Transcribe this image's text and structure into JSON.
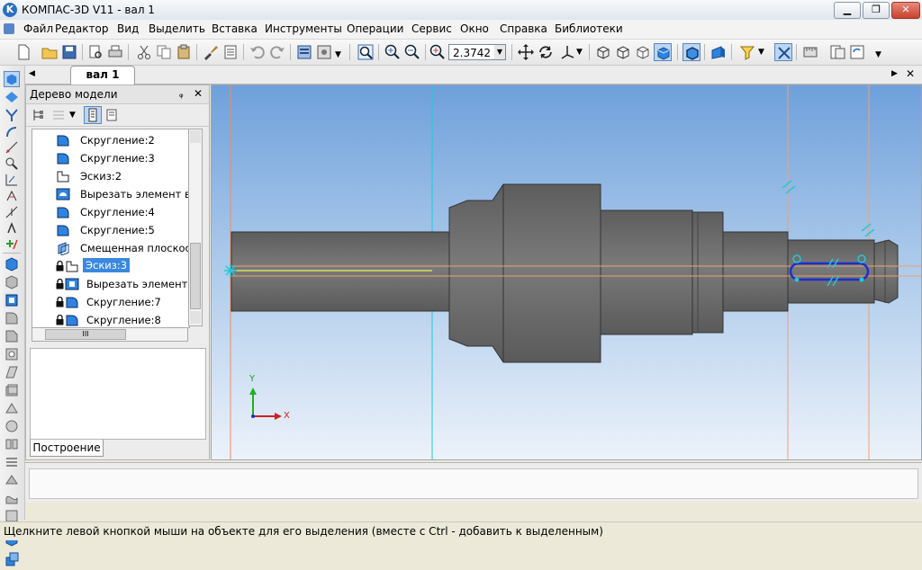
{
  "window": {
    "title": "КОМПАС-3D V11 - вал 1",
    "logo_letter": "K",
    "minimize_glyph": "▁",
    "restore_glyph": "❐",
    "close_glyph": "✕"
  },
  "menu": [
    "Файл",
    "Редактор",
    "Вид",
    "Выделить",
    "Вставка",
    "Инструменты",
    "Операции",
    "Сервис",
    "Окно",
    "Справка",
    "Библиотеки"
  ],
  "toolbar": {
    "zoom_value": "2.3742",
    "dropdown_glyph": "▼"
  },
  "document_tab": {
    "label": "вал 1",
    "left_arrow": "◀",
    "right_arrow": "▶",
    "close_glyph": "✕"
  },
  "model_tree": {
    "title": "Дерево модели",
    "pin_glyph": "ᵩ",
    "close_glyph": "✕",
    "items": [
      {
        "label": "Скругление:2",
        "icon": "fillet-icon",
        "locked": false,
        "selected": false
      },
      {
        "label": "Скругление:3",
        "icon": "fillet-icon",
        "locked": false,
        "selected": false
      },
      {
        "label": "Эскиз:2",
        "icon": "sketch-icon",
        "locked": false,
        "selected": false
      },
      {
        "label": "Вырезать элемент вр",
        "icon": "cut-revolve-icon",
        "locked": false,
        "selected": false
      },
      {
        "label": "Скругление:4",
        "icon": "fillet-icon",
        "locked": false,
        "selected": false
      },
      {
        "label": "Скругление:5",
        "icon": "fillet-icon",
        "locked": false,
        "selected": false
      },
      {
        "label": "Смещенная плоскост",
        "icon": "offset-plane-icon",
        "locked": false,
        "selected": false
      },
      {
        "label": "Эскиз:3",
        "icon": "sketch-icon",
        "locked": true,
        "selected": true
      },
      {
        "label": "Вырезать элемент в",
        "icon": "cut-extrude-icon",
        "locked": true,
        "selected": false
      },
      {
        "label": "Скругление:7",
        "icon": "fillet-icon",
        "locked": true,
        "selected": false
      },
      {
        "label": "Скругление:8",
        "icon": "fillet-icon",
        "locked": true,
        "selected": false
      }
    ],
    "scroll_grip": "III",
    "bottom_tab": "Построение"
  },
  "viewport": {
    "axis_x_label": "X",
    "axis_y_label": "Y",
    "background_top": "#6fa0db",
    "background_bottom": "#ecf2fa",
    "part_color": "#6e6e6e",
    "selection_color": "#1a2fd0",
    "axis_line_color": "#22c8d8",
    "plane_line_color": "#f08c5a"
  },
  "status": {
    "text": "Щелкните левой кнопкой мыши на объекте для его выделения (вместе с Ctrl - добавить к выделенным)"
  }
}
